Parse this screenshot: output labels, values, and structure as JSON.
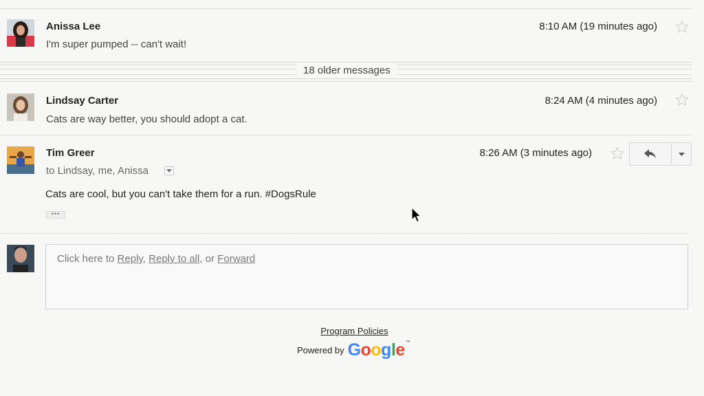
{
  "older": {
    "label": "18 older messages"
  },
  "messages": [
    {
      "sender": "Anissa Lee",
      "time": "8:10 AM (19 minutes ago)",
      "snippet": "I'm super pumped -- can't wait!"
    },
    {
      "sender": "Lindsay Carter",
      "time": "8:24 AM (4 minutes ago)",
      "snippet": "Cats are way better, you should adopt a cat."
    },
    {
      "sender": "Tim Greer",
      "time": "8:26 AM (3 minutes ago)",
      "recipients": "to Lindsay, me, Anissa",
      "body": "Cats are cool, but you can't take them for a run. #DogsRule"
    }
  ],
  "reply": {
    "prefix": "Click here to ",
    "reply_label": "Reply",
    "sep1": ", ",
    "reply_all_label": "Reply to all",
    "sep2": ", or ",
    "forward_label": "Forward"
  },
  "footer": {
    "program_policies": "Program Policies",
    "powered_by": "Powered by",
    "google": [
      "G",
      "o",
      "o",
      "g",
      "l",
      "e"
    ],
    "google_colors": [
      "#4285F4",
      "#EA4335",
      "#FBBC05",
      "#4285F4",
      "#34A853",
      "#EA4335"
    ],
    "tm": "™"
  },
  "icons": {
    "star": "star-icon",
    "reply": "reply-arrow-icon",
    "dropdown": "chevron-down-icon",
    "cursor": "mouse-pointer-icon"
  }
}
